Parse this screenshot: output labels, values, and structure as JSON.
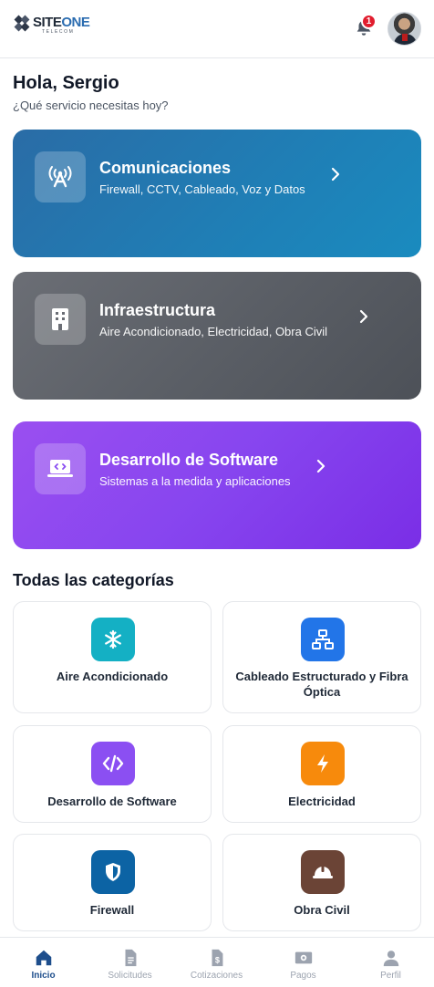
{
  "header": {
    "logo_main_a": "SITE",
    "logo_main_b": "ONE",
    "logo_sub": "TELECOM",
    "notification_count": "1",
    "avatar_icon": "user-avatar"
  },
  "greeting": {
    "title": "Hola, Sergio",
    "subtitle": "¿Qué servicio necesitas hoy?"
  },
  "hero_cards": [
    {
      "title": "Comunicaciones",
      "subtitle": "Firewall, CCTV, Cableado, Voz y Datos",
      "icon": "antenna-icon",
      "color": "#2a6ca6"
    },
    {
      "title": "Infraestructura",
      "subtitle": "Aire Acondicionado, Electricidad, Obra Civil",
      "icon": "building-icon",
      "color": "#5b5f66"
    },
    {
      "title": "Desarrollo de Software",
      "subtitle": "Sistemas a la medida y aplicaciones",
      "icon": "laptop-code-icon",
      "color": "#8745ef"
    }
  ],
  "categories_title": "Todas las categorías",
  "categories": [
    {
      "label": "Aire Acondicionado",
      "icon": "snowflake-icon",
      "color": "#14b0c4"
    },
    {
      "label": "Cableado Estructurado y Fibra Óptica",
      "icon": "network-icon",
      "color": "#2275e8"
    },
    {
      "label": "Desarrollo de Software",
      "icon": "code-icon",
      "color": "#8b4ff2"
    },
    {
      "label": "Electricidad",
      "icon": "bolt-icon",
      "color": "#f78a0c"
    },
    {
      "label": "Firewall",
      "icon": "shield-icon",
      "color": "#0c63a4"
    },
    {
      "label": "Obra Civil",
      "icon": "hard-hat-icon",
      "color": "#6b4436"
    }
  ],
  "bottom_nav": [
    {
      "label": "Inicio",
      "icon": "home-icon",
      "active": true
    },
    {
      "label": "Solicitudes",
      "icon": "document-icon",
      "active": false
    },
    {
      "label": "Cotizaciones",
      "icon": "invoice-dollar-icon",
      "active": false
    },
    {
      "label": "Pagos",
      "icon": "money-icon",
      "active": false
    },
    {
      "label": "Perfil",
      "icon": "user-icon",
      "active": false
    }
  ]
}
